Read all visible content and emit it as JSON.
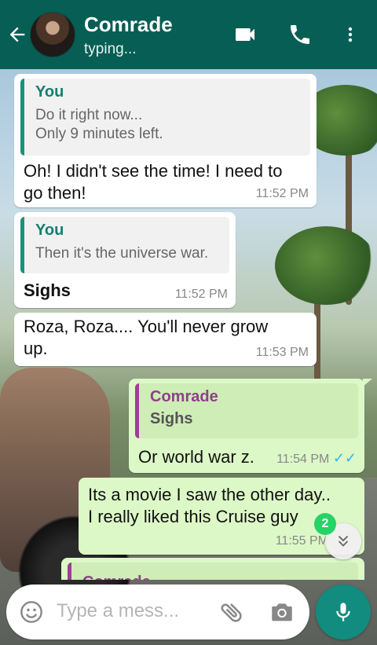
{
  "header": {
    "contact_name": "Comrade",
    "status": "typing..."
  },
  "messages": [
    {
      "direction": "incoming",
      "quote_author": "You",
      "quote_text_1": "Do it right now...",
      "quote_text_2": "Only 9 minutes left.",
      "text_1": "Oh! I didn't see the time! I need to",
      "text_2": "go then!",
      "time": "11:52 PM"
    },
    {
      "direction": "incoming",
      "quote_author": "You",
      "quote_text_1": "Then it's the universe war.",
      "text_1": "Sighs",
      "time": "11:52 PM"
    },
    {
      "direction": "incoming",
      "text_1": "Roza, Roza.... You'll never grow",
      "text_2": "up.",
      "time": "11:53 PM"
    },
    {
      "direction": "outgoing",
      "quote_author": "Comrade",
      "quote_text_1": "Sighs",
      "text_1": "Or world war z.",
      "time": "11:54 PM",
      "ticks": "✓✓"
    },
    {
      "direction": "outgoing",
      "text_1": "Its a movie I saw the other day..",
      "text_2": "I really liked this Cruise guy",
      "time": "11:55 PM"
    },
    {
      "direction": "outgoing",
      "quote_author": "Comrade"
    }
  ],
  "scroll": {
    "unread_count": "2"
  },
  "composer": {
    "placeholder": "Type a mess..."
  },
  "icons": {
    "back": "arrow-left-icon",
    "video": "videocam-icon",
    "call": "phone-icon",
    "menu": "more-vert-icon",
    "emoji": "emoji-icon",
    "attach": "paperclip-icon",
    "camera": "camera-icon",
    "mic": "mic-icon",
    "scroll": "double-chevron-down-icon"
  },
  "colors": {
    "header": "#075e54",
    "outgoing": "#dcf8c6",
    "incoming": "#ffffff",
    "accent": "#128c7e",
    "ticks": "#34b7f1",
    "badge": "#25d366"
  }
}
